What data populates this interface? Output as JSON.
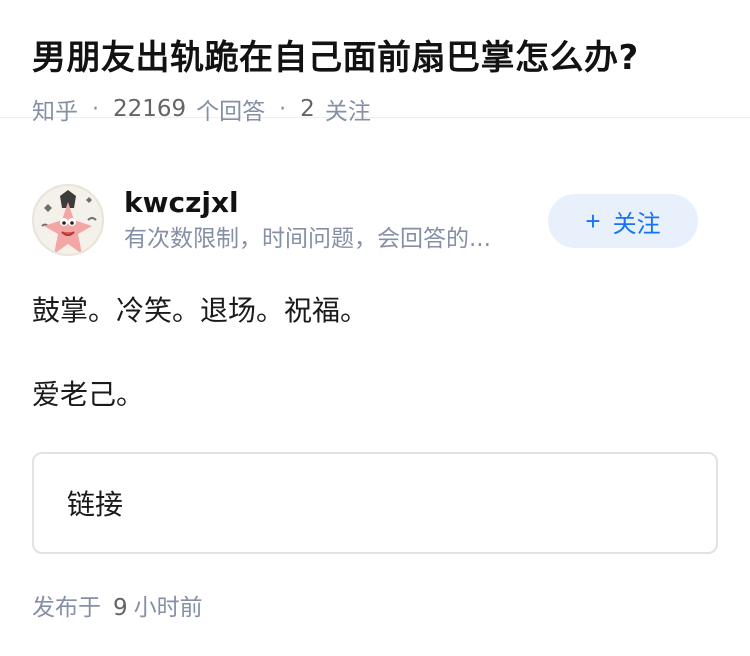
{
  "question": {
    "title": "男朋友出轨跪在自己面前扇巴掌怎么办?",
    "source": "知乎",
    "separator": "·",
    "answer_count": "22169",
    "answer_label": "个回答",
    "follow_count": "2",
    "follow_label": "关注"
  },
  "author": {
    "name": "kwczjxl",
    "bio": "有次数限制，时间问题，会回答的...",
    "avatar_icon": "patrick-star-avatar"
  },
  "follow_button": {
    "plus": "+",
    "label": "关注"
  },
  "answer": {
    "paragraphs": [
      "鼓掌。冷笑。退场。祝福。",
      "爱老己。"
    ]
  },
  "link_card": {
    "label": "链接"
  },
  "publish": {
    "prefix": "发布于",
    "number": "9",
    "suffix": "小时前"
  },
  "colors": {
    "accent": "#1772f6",
    "follow_bg": "#e8f1fb",
    "meta_gray": "#8590a6"
  }
}
